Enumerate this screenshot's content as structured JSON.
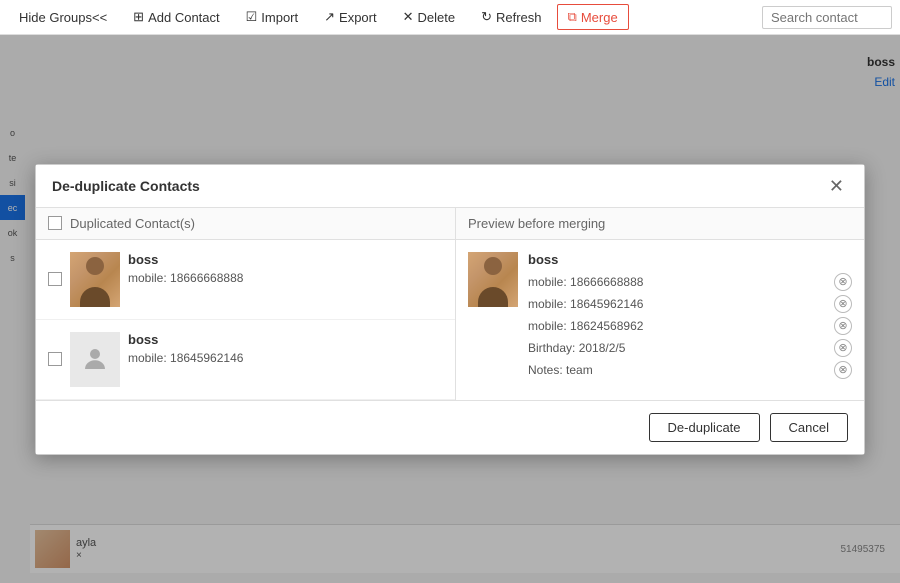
{
  "toolbar": {
    "hide_groups_label": "Hide Groups<<",
    "add_contact_label": "Add Contact",
    "import_label": "Import",
    "export_label": "Export",
    "delete_label": "Delete",
    "refresh_label": "Refresh",
    "merge_label": "Merge",
    "search_placeholder": "Search contact"
  },
  "modal": {
    "title": "De-duplicate Contacts",
    "left_panel": {
      "header": "Duplicated Contact(s)",
      "contacts": [
        {
          "name": "boss",
          "detail": "mobile: 18666668888",
          "has_photo": true
        },
        {
          "name": "boss",
          "detail": "mobile: 18645962146",
          "has_photo": false
        }
      ]
    },
    "right_panel": {
      "header": "Preview before merging",
      "contact": {
        "name": "boss",
        "fields": [
          {
            "text": "mobile: 18666668888"
          },
          {
            "text": "mobile: 18645962146"
          },
          {
            "text": "mobile: 18624568962"
          },
          {
            "text": "Birthday: 2018/2/5"
          },
          {
            "text": "Notes: team"
          }
        ]
      }
    },
    "footer": {
      "deduplicate_label": "De-duplicate",
      "cancel_label": "Cancel"
    }
  },
  "background": {
    "right_name": "boss",
    "edit_label": "Edit",
    "sidebar_items": [
      "o",
      "te",
      "si",
      "ec",
      "ok",
      "s"
    ],
    "active_item_index": 3
  }
}
